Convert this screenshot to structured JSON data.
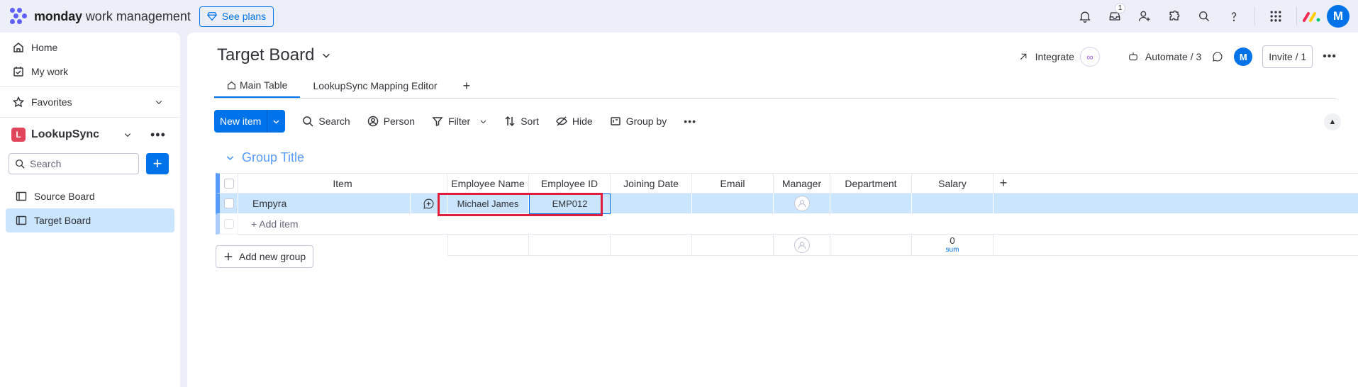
{
  "topbar": {
    "brand": "monday",
    "brand_sub": "work management",
    "see_plans": "See plans",
    "inbox_badge": "1",
    "avatar": "M",
    "icons": [
      "bell-icon",
      "inbox-icon",
      "invite-members-icon",
      "apps-icon",
      "search-icon",
      "help-icon",
      "app-grid-icon"
    ]
  },
  "sidebar": {
    "home": "Home",
    "my_work": "My work",
    "favorites": "Favorites",
    "workspace_badge": "L",
    "workspace": "LookupSync",
    "search_placeholder": "Search",
    "boards": [
      "Source Board",
      "Target Board"
    ]
  },
  "board": {
    "title": "Target Board",
    "tabs": [
      "Main Table",
      "LookupSync Mapping Editor"
    ],
    "integrate": "Integrate",
    "automate": "Automate / 3",
    "avatar": "M",
    "invite": "Invite / 1"
  },
  "toolbar": {
    "new_item": "New item",
    "search": "Search",
    "person": "Person",
    "filter": "Filter",
    "sort": "Sort",
    "hide": "Hide",
    "group_by": "Group by"
  },
  "group": {
    "title": "Group Title",
    "columns": [
      "Item",
      "Employee Name",
      "Employee ID",
      "Joining Date",
      "Email",
      "Manager",
      "Department",
      "Salary"
    ],
    "rows": [
      {
        "item": "Empyra",
        "employee_name": "Michael James",
        "employee_id": "EMP012",
        "joining_date": "",
        "email": "",
        "department": "",
        "salary": ""
      }
    ],
    "add_item": "+ Add item",
    "salary_sum": "0",
    "sum_label": "sum"
  },
  "add_new_group": "Add new group",
  "colors": {
    "accent": "#0073ea",
    "group": "#579bfc",
    "selected_row": "#cce5ff",
    "highlight": "#e01e3c"
  }
}
